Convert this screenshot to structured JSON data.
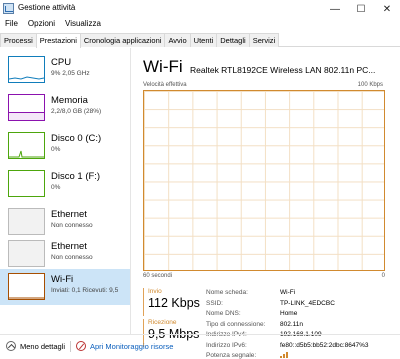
{
  "window": {
    "title": "Gestione attività"
  },
  "menu": [
    "File",
    "Opzioni",
    "Visualizza"
  ],
  "tabs": [
    "Processi",
    "Prestazioni",
    "Cronologia applicazioni",
    "Avvio",
    "Utenti",
    "Dettagli",
    "Servizi"
  ],
  "sidebar": [
    {
      "name": "CPU",
      "sub": "9% 2,05 GHz",
      "color": "#117dbb"
    },
    {
      "name": "Memoria",
      "sub": "2,2/8,0 GB (28%)",
      "color": "#8b12ae"
    },
    {
      "name": "Disco 0 (C:)",
      "sub": "0%",
      "color": "#4da60c"
    },
    {
      "name": "Disco 1 (F:)",
      "sub": "0%",
      "color": "#4da60c"
    },
    {
      "name": "Ethernet",
      "sub": "Non connesso",
      "color": "#bbbbbb"
    },
    {
      "name": "Ethernet",
      "sub": "Non connesso",
      "color": "#bbbbbb"
    },
    {
      "name": "Wi-Fi",
      "sub": "Inviati: 0,1 Ricevuti: 9,5",
      "color": "#a74f01"
    }
  ],
  "main": {
    "title": "Wi-Fi",
    "adapter": "Realtek RTL8192CE Wireless LAN 802.11n PC...",
    "graph_label": "Velocità effettiva",
    "graph_max": "100 Kbps",
    "axis_left": "60 secondi",
    "axis_right": "0",
    "send_label": "Invio",
    "send_value": "112 Kbps",
    "recv_label": "Ricezione",
    "recv_value": "9,5 Mbps",
    "details": [
      {
        "k": "Nome scheda:",
        "v": "Wi-Fi"
      },
      {
        "k": "SSID:",
        "v": "TP-LINK_4EDCBC"
      },
      {
        "k": "Nome DNS:",
        "v": "Home"
      },
      {
        "k": "Tipo di connessione:",
        "v": "802.11n"
      },
      {
        "k": "Indirizzo IPv4:",
        "v": "192.168.1.109"
      },
      {
        "k": "Indirizzo IPv6:",
        "v": "fe80::d5b5:bb52:2dbc:8647%3"
      },
      {
        "k": "Potenza segnale:",
        "v": ""
      }
    ],
    "signal_bars": 3
  },
  "footer": {
    "less_details": "Meno dettagli",
    "open_monitor": "Apri Monitoraggio risorse"
  },
  "colors": {
    "accent": "#d18a2f",
    "selected": "#cce4f7",
    "link": "#0b5fbd"
  }
}
